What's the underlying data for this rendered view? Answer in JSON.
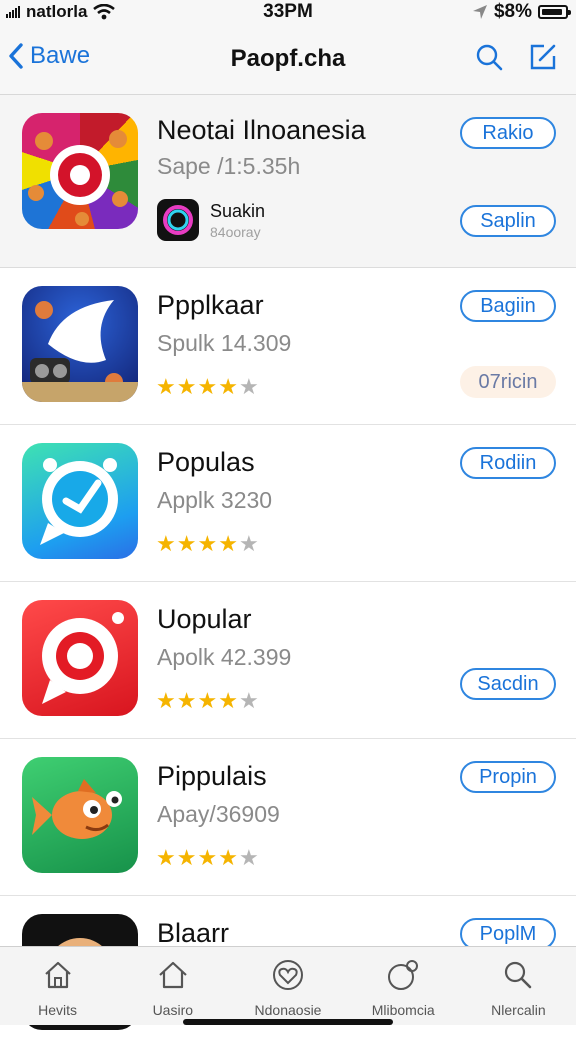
{
  "status_bar": {
    "carrier": "natlorla",
    "time": "33PM",
    "battery": "$8%"
  },
  "nav": {
    "back_label": "Bawe",
    "title": "Paopf.cha"
  },
  "featured": {
    "name": "Neotai Ilnoanesia",
    "subtitle": "Sape /1:5.35h",
    "button": "Rakio",
    "mini_title": "Suakin",
    "mini_sub": "84ooray",
    "mini_button": "Saplin"
  },
  "apps": [
    {
      "name": "Ppplkaar",
      "subtitle": "Spulk 14.309",
      "rating": 4,
      "button": "Bagiin",
      "secondary_button": "07ricin"
    },
    {
      "name": "Populas",
      "subtitle": "Applk 3230",
      "rating": 4,
      "button": "Rodiin"
    },
    {
      "name": "Uopular",
      "subtitle": "Apolk 42.399",
      "rating": 4,
      "button": "Sacdin"
    },
    {
      "name": "Pippulais",
      "subtitle": "Apay/36909",
      "rating": 4,
      "button": "Propin"
    },
    {
      "name": "Blaarr",
      "button": "PoplM"
    }
  ],
  "tabs": [
    {
      "label": "Hevits",
      "icon": "home-icon"
    },
    {
      "label": "Uasiro",
      "icon": "house-icon"
    },
    {
      "label": "Ndonaosie",
      "icon": "heart-icon"
    },
    {
      "label": "Mlibomcia",
      "icon": "profile-icon"
    },
    {
      "label": "Nlercalin",
      "icon": "search-icon"
    }
  ],
  "colors": {
    "accent": "#1a73d9",
    "star": "#f5b400"
  }
}
